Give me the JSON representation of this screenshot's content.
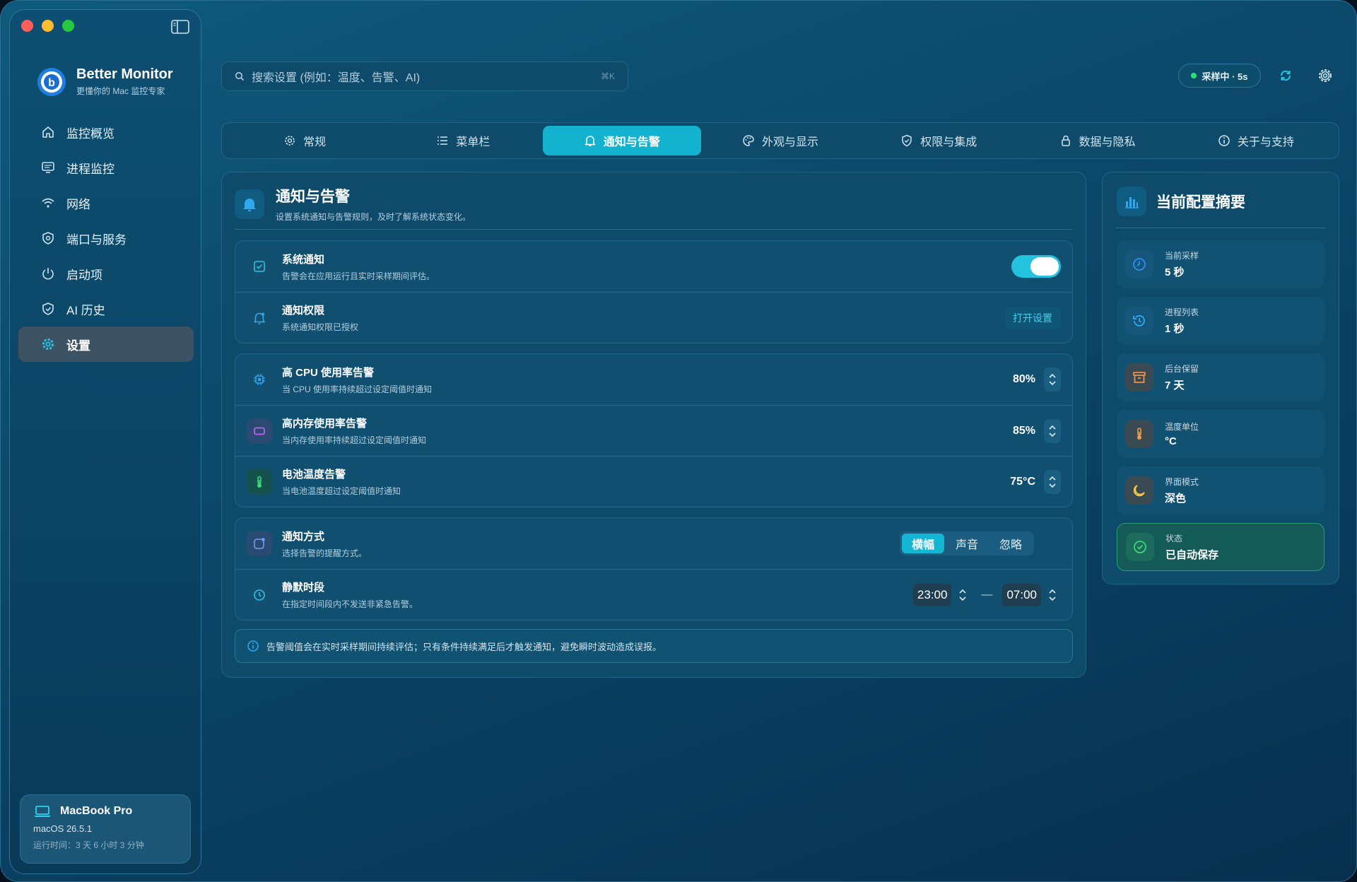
{
  "app": {
    "name": "Better Monitor",
    "tagline": "更懂你的 Mac 监控专家"
  },
  "sidebar": {
    "items": [
      {
        "label": "监控概览",
        "icon": "home-icon"
      },
      {
        "label": "进程监控",
        "icon": "monitor-icon"
      },
      {
        "label": "网络",
        "icon": "wifi-icon"
      },
      {
        "label": "端口与服务",
        "icon": "shield-icon"
      },
      {
        "label": "启动项",
        "icon": "power-icon"
      },
      {
        "label": "AI 历史",
        "icon": "shield-check-icon"
      },
      {
        "label": "设置",
        "icon": "gear-icon"
      }
    ],
    "active": "设置"
  },
  "device": {
    "name": "MacBook Pro",
    "os": "macOS 26.5.1",
    "uptime": "运行时间：3 天 6 小时 3 分钟"
  },
  "header": {
    "search_placeholder": "搜索设置 (例如：温度、告警、AI)",
    "search_shortcut": "⌘K",
    "sampling_status": "采样中 · 5s"
  },
  "tabs": [
    {
      "label": "常规",
      "icon": "gear-icon"
    },
    {
      "label": "菜单栏",
      "icon": "list-icon"
    },
    {
      "label": "通知与告警",
      "icon": "bell-icon"
    },
    {
      "label": "外观与显示",
      "icon": "palette-icon"
    },
    {
      "label": "权限与集成",
      "icon": "shield-check-icon"
    },
    {
      "label": "数据与隐私",
      "icon": "lock-icon"
    },
    {
      "label": "关于与支持",
      "icon": "info-icon"
    }
  ],
  "active_tab": "通知与告警",
  "panel": {
    "title": "通知与告警",
    "subtitle": "设置系统通知与告警规则，及时了解系统状态变化。",
    "system_notify": {
      "title": "系统通知",
      "subtitle": "告警会在应用运行且实时采样期间评估。",
      "enabled": true
    },
    "notify_permission": {
      "title": "通知权限",
      "subtitle": "系统通知权限已授权",
      "action": "打开设置"
    },
    "alerts": [
      {
        "title": "高 CPU 使用率告警",
        "subtitle": "当 CPU 使用率持续超过设定阈值时通知",
        "value": "80%"
      },
      {
        "title": "高内存使用率告警",
        "subtitle": "当内存使用率持续超过设定阈值时通知",
        "value": "85%"
      },
      {
        "title": "电池温度告警",
        "subtitle": "当电池温度超过设定阈值时通知",
        "value": "75°C"
      }
    ],
    "notify_method": {
      "title": "通知方式",
      "subtitle": "选择告警的提醒方式。",
      "options": [
        "横幅",
        "声音",
        "忽略"
      ],
      "selected": "横幅"
    },
    "quiet_hours": {
      "title": "静默时段",
      "subtitle": "在指定时间段内不发送非紧急告警。",
      "start": "23:00",
      "separator": "—",
      "end": "07:00"
    },
    "info_note": "告警阈值会在实时采样期间持续评估；只有条件持续满足后才触发通知，避免瞬时波动造成误报。"
  },
  "summary": {
    "title": "当前配置摘要",
    "items": [
      {
        "label": "当前采样",
        "value": "5 秒",
        "icon": "clock-icon"
      },
      {
        "label": "进程列表",
        "value": "1 秒",
        "icon": "history-icon"
      },
      {
        "label": "后台保留",
        "value": "7 天",
        "icon": "archive-icon"
      },
      {
        "label": "温度单位",
        "value": "°C",
        "icon": "thermometer-icon"
      },
      {
        "label": "界面模式",
        "value": "深色",
        "icon": "moon-icon"
      },
      {
        "label": "状态",
        "value": "已自动保存",
        "icon": "check-circle-icon"
      }
    ]
  },
  "colors": {
    "accent": "#13b2cf",
    "background": "#0c4a6c",
    "status_ok": "#2ee07a"
  }
}
